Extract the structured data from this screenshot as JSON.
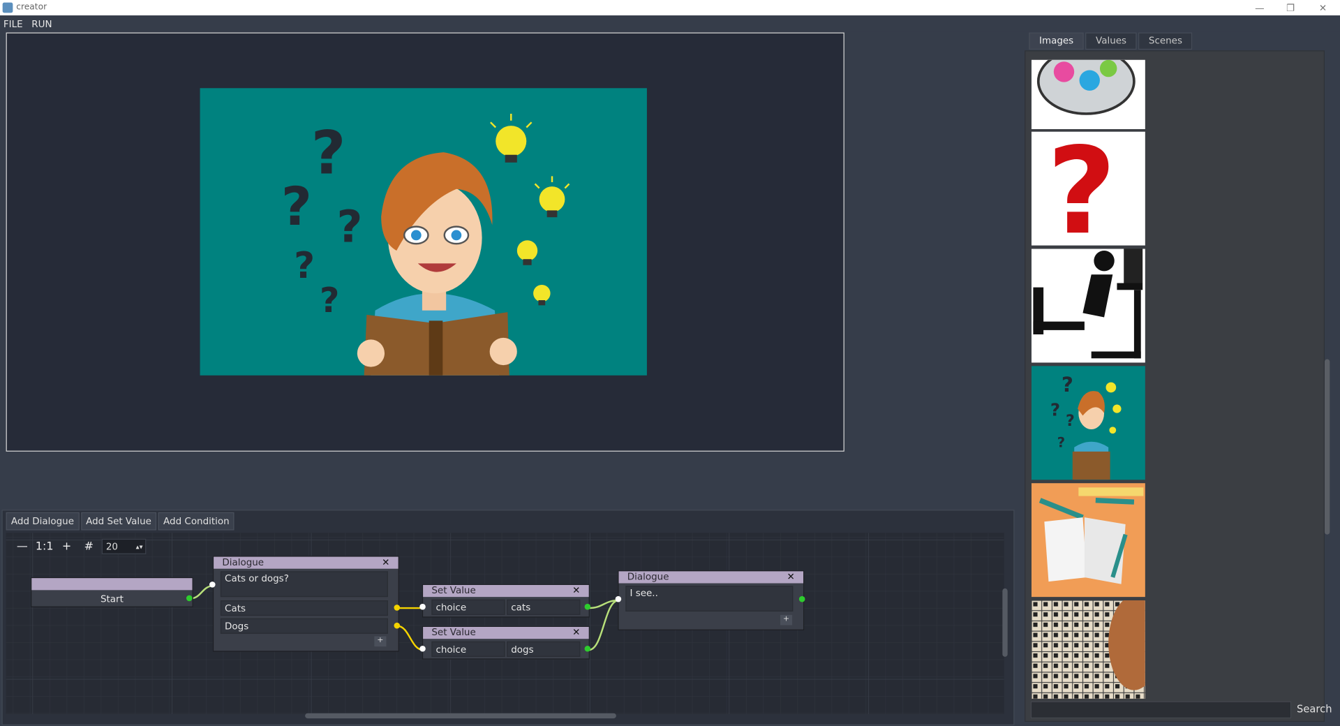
{
  "window": {
    "title": "creator"
  },
  "menu": {
    "file": "FILE",
    "run": "RUN"
  },
  "editor": {
    "toolbar": {
      "add_dialogue": "Add Dialogue",
      "add_set_value": "Add Set Value",
      "add_condition": "Add Condition"
    },
    "controls": {
      "zoom_reset": "1:1",
      "snap_value": "20"
    },
    "nodes": {
      "start": {
        "label": "Start"
      },
      "dialogue1": {
        "title": "Dialogue",
        "text": "Cats or dogs?",
        "choices": [
          "Cats",
          "Dogs"
        ]
      },
      "setvalue1": {
        "title": "Set Value",
        "key": "choice",
        "value": "cats"
      },
      "setvalue2": {
        "title": "Set Value",
        "key": "choice",
        "value": "dogs"
      },
      "dialogue2": {
        "title": "Dialogue",
        "text": "I see.."
      }
    }
  },
  "sidebar": {
    "tabs": [
      "Images",
      "Values",
      "Scenes"
    ],
    "active_tab": "Images",
    "images": [
      "quiz-bubble",
      "red-question-mark",
      "thinking-person-silhouette",
      "girl-with-book-and-questions",
      "notebook-and-pens",
      "crossword-puzzle"
    ],
    "search_label": "Search",
    "search_value": ""
  },
  "colors": {
    "background": "#363d4a",
    "node_header": "#b4a6c4",
    "preview_bg": "#00827f",
    "port_green": "#2ecc2e",
    "port_yellow": "#f5d400"
  }
}
